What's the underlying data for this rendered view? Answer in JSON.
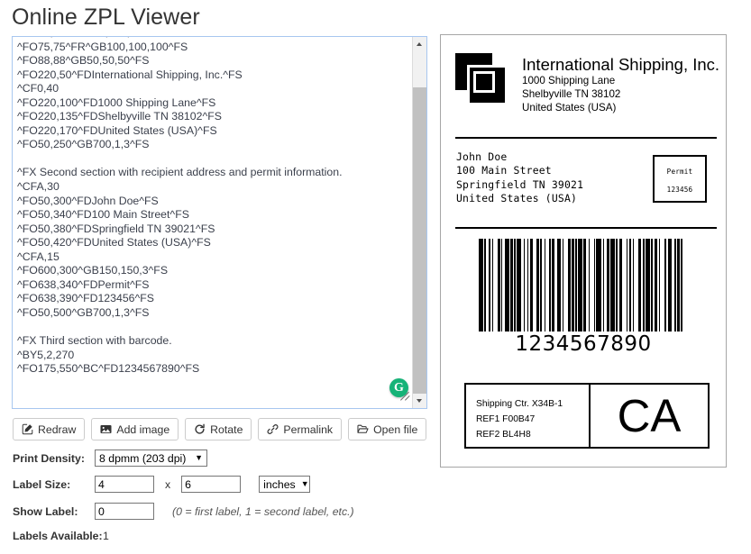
{
  "page": {
    "title": "Online ZPL Viewer"
  },
  "editor": {
    "name": "zpl-source-code",
    "code": "^FO50,50^GB100,100,100^FS\n^FO75,75^FR^GB100,100,100^FS\n^FO88,88^GB50,50,50^FS\n^FO220,50^FDInternational Shipping, Inc.^FS\n^CF0,40\n^FO220,100^FD1000 Shipping Lane^FS\n^FO220,135^FDShelbyville TN 38102^FS\n^FO220,170^FDUnited States (USA)^FS\n^FO50,250^GB700,1,3^FS\n\n^FX Second section with recipient address and permit information.\n^CFA,30\n^FO50,300^FDJohn Doe^FS\n^FO50,340^FD100 Main Street^FS\n^FO50,380^FDSpringfield TN 39021^FS\n^FO50,420^FDUnited States (USA)^FS\n^CFA,15\n^FO600,300^GB150,150,3^FS\n^FO638,340^FDPermit^FS\n^FO638,390^FD123456^FS\n^FO50,500^GB700,1,3^FS\n\n^FX Third section with barcode.\n^BY5,2,270\n^FO175,550^BC^FD1234567890^FS",
    "assistant_badge": "G"
  },
  "toolbar": {
    "buttons": [
      {
        "label": "Redraw",
        "icon": "pencil-square-icon"
      },
      {
        "label": "Add image",
        "icon": "image-icon"
      },
      {
        "label": "Rotate",
        "icon": "rotate-icon"
      },
      {
        "label": "Permalink",
        "icon": "link-icon"
      },
      {
        "label": "Open file",
        "icon": "folder-open-icon"
      }
    ]
  },
  "form": {
    "print_density": {
      "label": "Print Density:",
      "value": "8 dpmm (203 dpi)"
    },
    "label_size": {
      "label": "Label Size:",
      "width": "4",
      "separator": "x",
      "height": "6",
      "unit": "inches"
    },
    "show_label": {
      "label": "Show Label:",
      "value": "0",
      "hint": "(0 = first label, 1 = second label, etc.)"
    },
    "labels_available": {
      "label": "Labels Available:",
      "value": "1"
    }
  },
  "label_preview": {
    "sender": {
      "name": "International Shipping, Inc.",
      "address_line_1": "1000 Shipping Lane",
      "address_line_2": "Shelbyville TN 38102",
      "address_line_3": "United States (USA)"
    },
    "recipient": {
      "text": "John Doe\n100 Main Street\nSpringfield TN 39021\nUnited States (USA)"
    },
    "permit": {
      "title": "Permit",
      "number": "123456"
    },
    "barcode": {
      "value": "1234567890",
      "symbology": "Code 128",
      "pattern": [
        3,
        1,
        1,
        2,
        2,
        1,
        1,
        3,
        2,
        1,
        1,
        2,
        3,
        1,
        2,
        1,
        1,
        1,
        3,
        2,
        1,
        2,
        1,
        1,
        2,
        3,
        2,
        1,
        1,
        2,
        1,
        3,
        1,
        1,
        2,
        2,
        3,
        1,
        1,
        3,
        2,
        1,
        2,
        1,
        1,
        1,
        3,
        1,
        2,
        2,
        1,
        3,
        1,
        1,
        4,
        1,
        1,
        2,
        2,
        1,
        3,
        1,
        1,
        2,
        2,
        3,
        1,
        1,
        2,
        1,
        1,
        3,
        2,
        2,
        1,
        1,
        3,
        1,
        1,
        2,
        2,
        1,
        1,
        3,
        2,
        1,
        3,
        2,
        1,
        1,
        2,
        1,
        1,
        4
      ]
    },
    "references": {
      "line_1": "Shipping Ctr. X34B-1",
      "line_2": "REF1 F00B47",
      "line_3": "REF2 BL4H8"
    },
    "country_code": "CA"
  }
}
